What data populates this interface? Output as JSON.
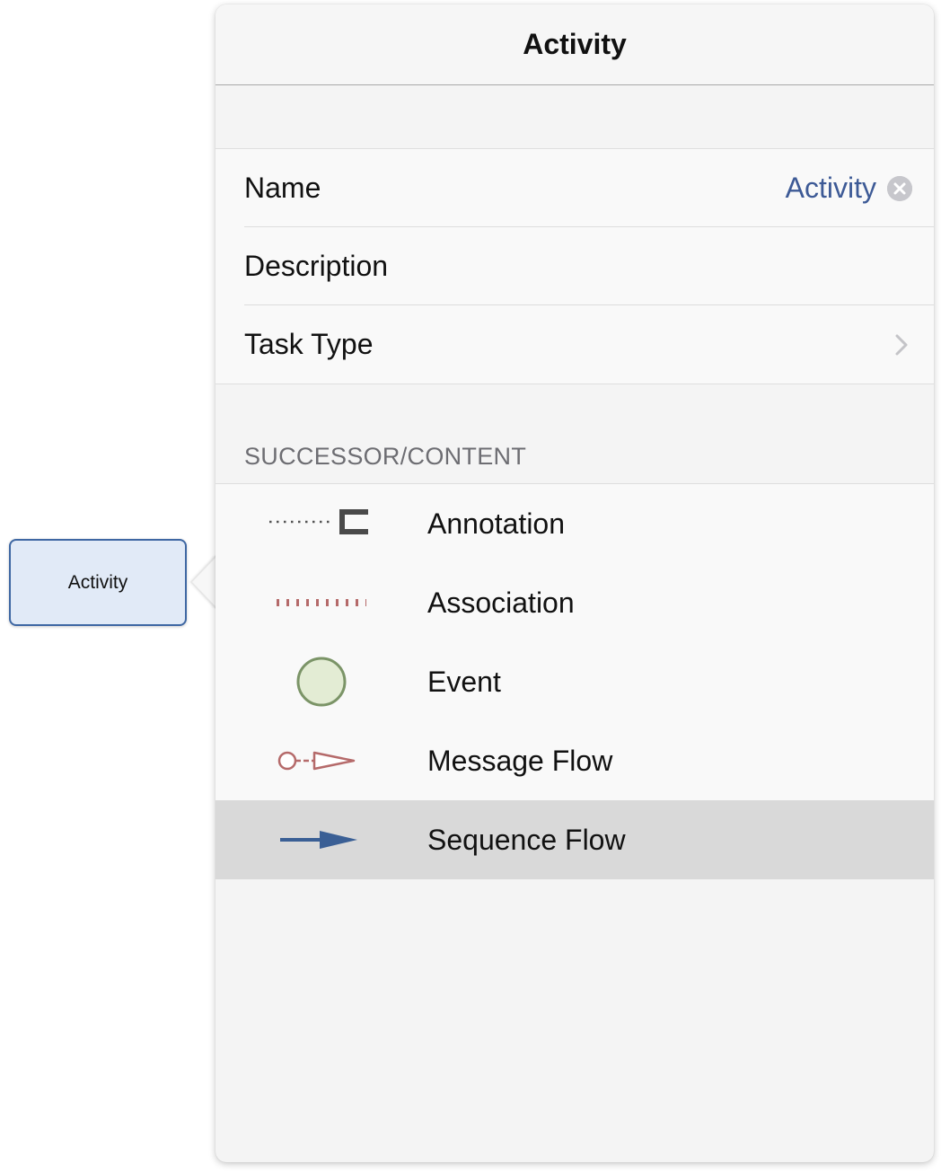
{
  "canvas": {
    "node_label": "Activity"
  },
  "popover": {
    "title": "Activity",
    "fields": {
      "name_label": "Name",
      "name_value": "Activity",
      "description_label": "Description",
      "task_type_label": "Task Type"
    },
    "section_header": "SUCCESSOR/CONTENT",
    "items": [
      {
        "label": "Annotation",
        "icon": "annotation-icon"
      },
      {
        "label": "Association",
        "icon": "association-icon"
      },
      {
        "label": "Event",
        "icon": "event-icon"
      },
      {
        "label": "Message Flow",
        "icon": "message-flow-icon"
      },
      {
        "label": "Sequence Flow",
        "icon": "sequence-flow-icon",
        "selected": true
      }
    ]
  },
  "colors": {
    "link_blue": "#3d5a96",
    "node_fill": "#e1eaf7",
    "node_border": "#3e67a3",
    "selected_row": "#d9d9d9"
  }
}
